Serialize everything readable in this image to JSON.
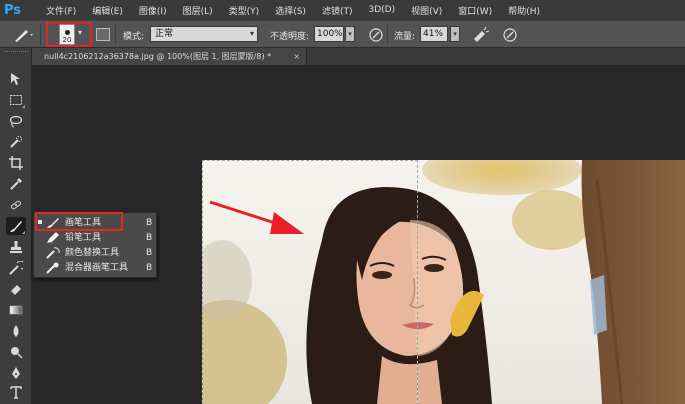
{
  "app": {
    "logo": "Ps"
  },
  "menu": [
    "文件(F)",
    "编辑(E)",
    "图像(I)",
    "图层(L)",
    "类型(Y)",
    "选择(S)",
    "滤镜(T)",
    "3D(D)",
    "视图(V)",
    "窗口(W)",
    "帮助(H)"
  ],
  "options": {
    "brush_size": "20",
    "mode_label": "模式:",
    "mode_value": "正常",
    "opacity_label": "不透明度:",
    "opacity_value": "100%",
    "flow_label": "流量:",
    "flow_value": "41%"
  },
  "document": {
    "tab_title": "null4c2106212a36378a.jpg @ 100%(图层 1, 图层蒙版/8) *",
    "close_glyph": "×"
  },
  "flyout": {
    "items": [
      {
        "label": "画笔工具",
        "shortcut": "B",
        "selected": true
      },
      {
        "label": "铅笔工具",
        "shortcut": "B",
        "selected": false
      },
      {
        "label": "颜色替换工具",
        "shortcut": "B",
        "selected": false
      },
      {
        "label": "混合器画笔工具",
        "shortcut": "B",
        "selected": false
      }
    ]
  },
  "tools": [
    "move-icon",
    "marquee-icon",
    "lasso-icon",
    "quick-select-icon",
    "crop-icon",
    "eyedropper-icon",
    "healing-icon",
    "brush-icon",
    "clone-stamp-icon",
    "history-brush-icon",
    "eraser-icon",
    "gradient-icon",
    "blur-icon",
    "dodge-icon",
    "pen-icon",
    "type-icon"
  ],
  "colors": {
    "highlight_red": "#e02626",
    "ps_blue": "#31a8ff",
    "annotation_arrow": "#e8202a"
  }
}
